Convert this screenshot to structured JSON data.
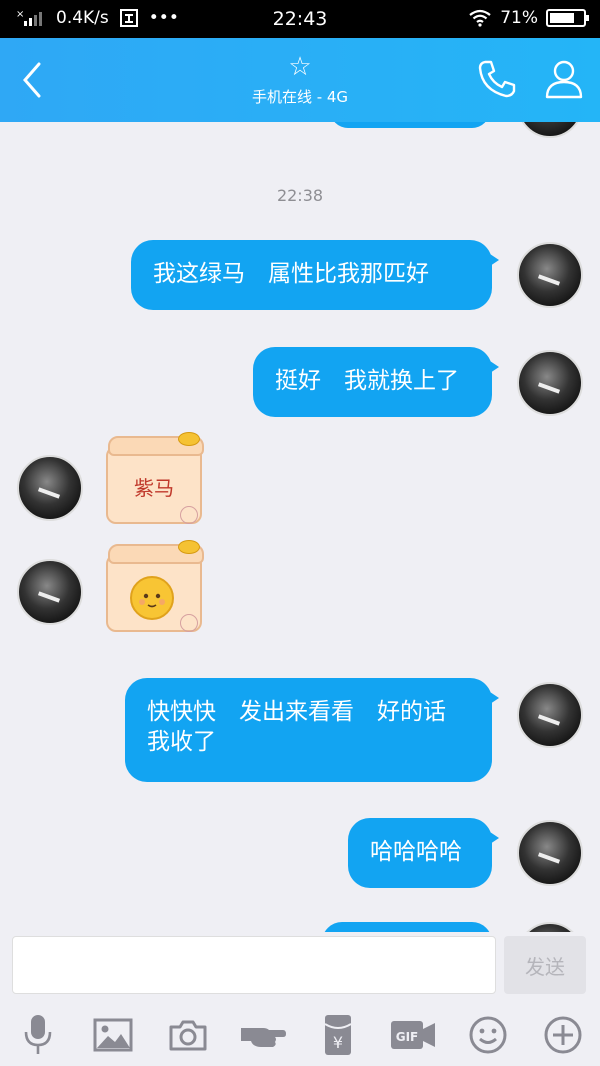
{
  "status_bar": {
    "network_speed": "0.4K/s",
    "dots": "•••",
    "time": "22:43",
    "battery": "71%"
  },
  "header": {
    "star_icon": "☆",
    "subtitle": "手机在线 - 4G"
  },
  "chat": {
    "timestamp": "22:38",
    "messages": [
      {
        "side": "right",
        "text": "我这绿马　属性比我那匹好"
      },
      {
        "side": "right",
        "text": "挺好　我就换上了"
      },
      {
        "side": "left",
        "sticker_text": "紫马"
      },
      {
        "side": "left",
        "sticker": "smiley-face"
      },
      {
        "side": "right",
        "line1": "快快快　发出来看看　好的话",
        "line2": "我收了"
      },
      {
        "side": "right",
        "text": "哈哈哈哈"
      }
    ]
  },
  "input": {
    "placeholder": "",
    "send_label": "发送"
  },
  "toolbar": {
    "icons": [
      "microphone-icon",
      "image-icon",
      "camera-icon",
      "poke-icon",
      "red-packet-icon",
      "gif-icon",
      "emoji-icon",
      "plus-icon"
    ],
    "red_packet_symbol": "¥",
    "gif_label": "GIF"
  },
  "colors": {
    "header": "#2fa8f5",
    "bubble": "#12a4f2",
    "background": "#efeff4"
  }
}
